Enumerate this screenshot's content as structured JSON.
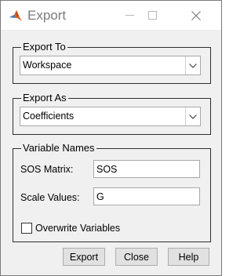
{
  "window": {
    "title": "Export",
    "icon": "matlab-logo-icon",
    "controls": [
      "minimize-icon",
      "maximize-icon",
      "close-icon"
    ]
  },
  "export_to": {
    "title": "Export To",
    "value": "Workspace"
  },
  "export_as": {
    "title": "Export As",
    "value": "Coefficients"
  },
  "variable_names": {
    "title": "Variable Names",
    "sos_label": "SOS Matrix:",
    "sos_value": "SOS",
    "scale_label": "Scale Values:",
    "scale_value": "G",
    "overwrite_label": "Overwrite Variables",
    "overwrite_checked": false
  },
  "buttons": {
    "export": "Export",
    "close": "Close",
    "help": "Help"
  },
  "colors": {
    "window_bg": "#f0f0f0",
    "title_text": "#7c7c7c",
    "group_border": "#2e2e2e"
  }
}
